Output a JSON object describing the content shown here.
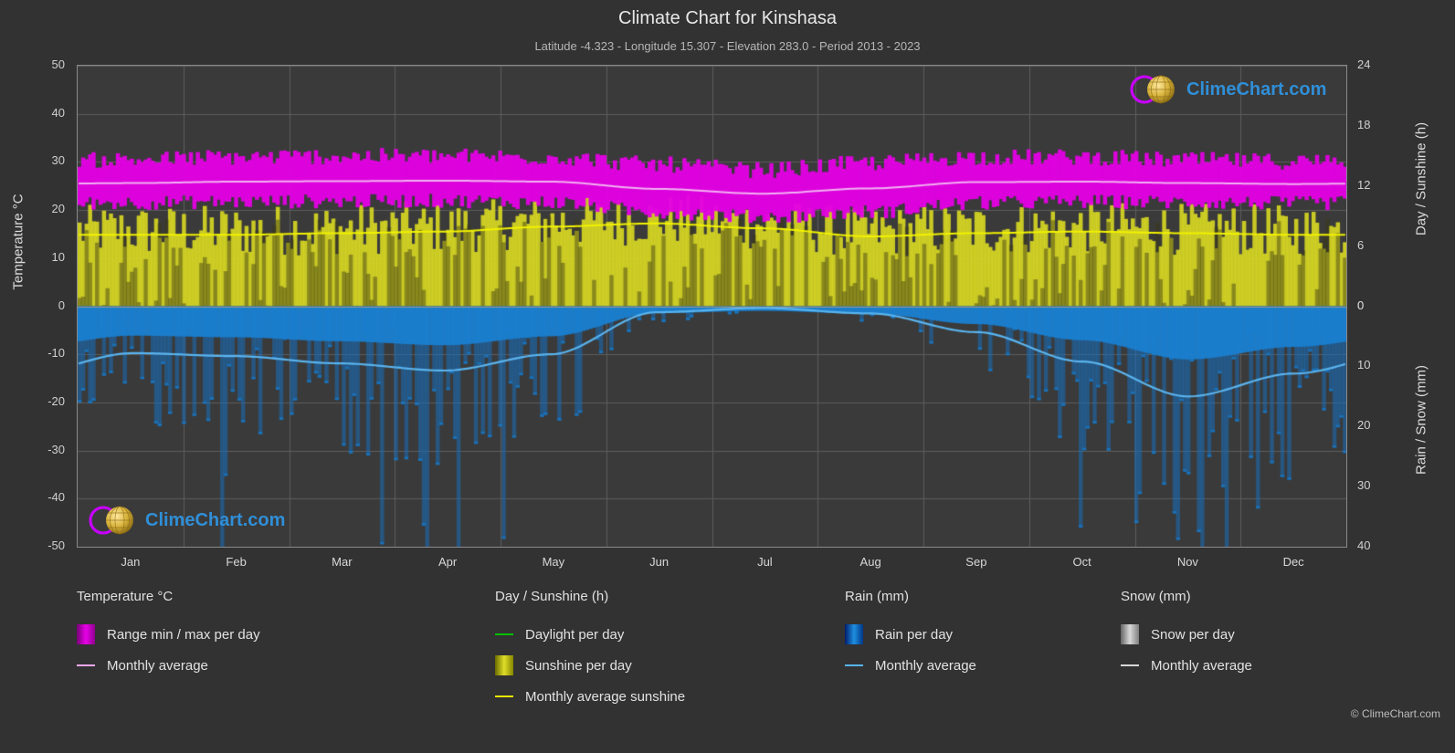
{
  "header": {
    "title": "Climate Chart for Kinshasa",
    "subtitle": "Latitude -4.323 - Longitude 15.307 - Elevation 283.0 - Period 2013 - 2023"
  },
  "watermark": {
    "text": "ClimeChart.com"
  },
  "copyright": "© ClimeChart.com",
  "axes": {
    "left_label": "Temperature °C",
    "right_label_top": "Day / Sunshine (h)",
    "right_label_bottom": "Rain / Snow (mm)",
    "left_ticks": [
      "50",
      "40",
      "30",
      "20",
      "10",
      "0",
      "-10",
      "-20",
      "-30",
      "-40",
      "-50"
    ],
    "right_top_ticks": [
      "24",
      "18",
      "12",
      "6",
      "0"
    ],
    "right_bottom_ticks": [
      "0",
      "10",
      "20",
      "30",
      "40"
    ],
    "x_ticks": [
      "Jan",
      "Feb",
      "Mar",
      "Apr",
      "May",
      "Jun",
      "Jul",
      "Aug",
      "Sep",
      "Oct",
      "Nov",
      "Dec"
    ]
  },
  "legend": {
    "columns": [
      {
        "heading": "Temperature °C",
        "items": [
          {
            "label": "Range min / max per day",
            "type": "swatch",
            "color": "#e800e8"
          },
          {
            "label": "Monthly average",
            "type": "line",
            "color": "#f0a8f0"
          }
        ]
      },
      {
        "heading": "Day / Sunshine (h)",
        "items": [
          {
            "label": "Daylight per day",
            "type": "line",
            "color": "#00c000"
          },
          {
            "label": "Sunshine per day",
            "type": "swatch",
            "color": "#dede28"
          },
          {
            "label": "Monthly average sunshine",
            "type": "line",
            "color": "#e8e800"
          }
        ]
      },
      {
        "heading": "Rain (mm)",
        "items": [
          {
            "label": "Rain per day",
            "type": "swatch",
            "color": "#1e8fe0"
          },
          {
            "label": "Monthly average",
            "type": "line",
            "color": "#58b4ec"
          }
        ]
      },
      {
        "heading": "Snow (mm)",
        "items": [
          {
            "label": "Snow per day",
            "type": "swatch",
            "color": "#d8d8d8"
          },
          {
            "label": "Monthly average",
            "type": "line",
            "color": "#d8d8d8"
          }
        ]
      }
    ]
  },
  "chart_data": {
    "type": "area",
    "title": "Climate Chart for Kinshasa",
    "subtitle": "Latitude -4.323 - Longitude 15.307 - Elevation 283.0 - Period 2013 - 2023",
    "xlabel": "",
    "ylabel": "Temperature °C",
    "ylim": [
      -50,
      50
    ],
    "y2lim_top": [
      0,
      24
    ],
    "y2lim_bottom": [
      0,
      40
    ],
    "grid": true,
    "legend_position": "below",
    "categories": [
      "Jan",
      "Feb",
      "Mar",
      "Apr",
      "May",
      "Jun",
      "Jul",
      "Aug",
      "Sep",
      "Oct",
      "Nov",
      "Dec"
    ],
    "series": [
      {
        "name": "Temperature monthly average (°C)",
        "color": "#f0a8f0",
        "values": [
          25.6,
          25.9,
          26.0,
          26.1,
          25.9,
          24.4,
          23.4,
          24.5,
          25.8,
          25.9,
          25.6,
          25.4
        ]
      },
      {
        "name": "Daily temperature range min/max (°C)",
        "color": "#e800e8",
        "min": [
          21.5,
          21.7,
          21.8,
          21.9,
          21.6,
          19.6,
          18.6,
          19.6,
          21.4,
          21.7,
          21.6,
          21.4
        ],
        "max": [
          30.5,
          31.0,
          31.2,
          31.2,
          31.0,
          29.5,
          28.3,
          29.8,
          31.0,
          31.0,
          30.4,
          30.1
        ]
      },
      {
        "name": "Sunshine monthly average (h)",
        "color": "#e8e800",
        "values": [
          4.4,
          4.4,
          4.5,
          4.6,
          4.9,
          5.1,
          4.8,
          4.3,
          4.5,
          4.6,
          4.5,
          4.4
        ]
      },
      {
        "name": "Sunshine per day (h)",
        "color": "#dede28",
        "values": [
          4.4,
          4.4,
          4.5,
          4.6,
          4.9,
          5.1,
          4.8,
          4.3,
          4.5,
          4.6,
          4.5,
          4.4
        ]
      },
      {
        "name": "Rain monthly average (mm)",
        "color": "#58b4ec",
        "values": [
          7.8,
          8.3,
          9.5,
          10.7,
          8.0,
          1.0,
          0.3,
          1.2,
          4.3,
          9.2,
          15.0,
          11.2
        ]
      }
    ]
  }
}
